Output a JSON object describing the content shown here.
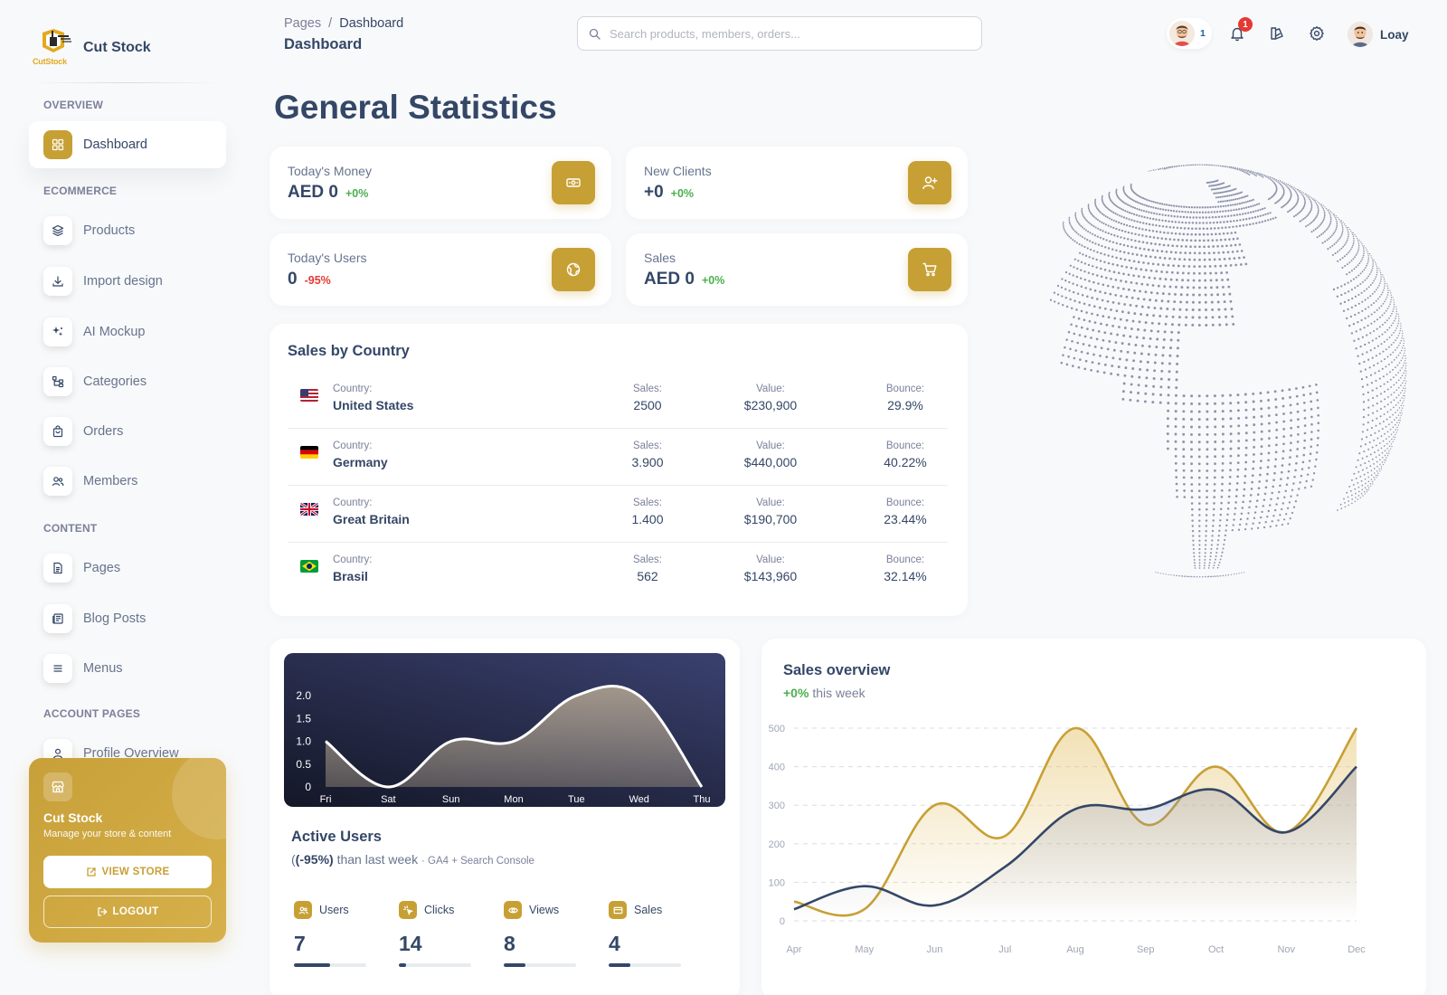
{
  "brand": {
    "name": "Cut Stock",
    "logo_text": "CutStock"
  },
  "sidebar": {
    "sections": {
      "overview": "OVERVIEW",
      "ecommerce": "ECOMMERCE",
      "content": "CONTENT",
      "account": "ACCOUNT PAGES"
    },
    "items": [
      {
        "label": "Dashboard",
        "icon": "dashboard-icon"
      },
      {
        "label": "Products",
        "icon": "layers-icon"
      },
      {
        "label": "Import design",
        "icon": "download-icon"
      },
      {
        "label": "AI Mockup",
        "icon": "sparkle-icon"
      },
      {
        "label": "Categories",
        "icon": "hierarchy-icon"
      },
      {
        "label": "Orders",
        "icon": "shopping-bag-icon"
      },
      {
        "label": "Members",
        "icon": "users-icon"
      },
      {
        "label": "Pages",
        "icon": "file-icon"
      },
      {
        "label": "Blog Posts",
        "icon": "newspaper-icon"
      },
      {
        "label": "Menus",
        "icon": "menu-icon"
      },
      {
        "label": "Profile Overview",
        "icon": "user-icon"
      }
    ],
    "store_card": {
      "title": "Cut Stock",
      "subtitle": "Manage your store & content",
      "view_store": "VIEW STORE",
      "logout": "LOGOUT"
    }
  },
  "topbar": {
    "breadcrumb_root": "Pages",
    "breadcrumb_sep": "/",
    "breadcrumb_current": "Dashboard",
    "title": "Dashboard",
    "search_placeholder": "Search products, members, orders...",
    "online_count": "1",
    "notification_count": "1",
    "user_name": "Loay"
  },
  "page_title": "General Statistics",
  "stats": [
    {
      "label": "Today's Money",
      "value": "AED 0",
      "change": "+0%",
      "trend": "positive",
      "icon": "money-icon"
    },
    {
      "label": "New Clients",
      "value": "+0",
      "change": "+0%",
      "trend": "positive",
      "icon": "user-plus-icon"
    },
    {
      "label": "Today's Users",
      "value": "0",
      "change": "-95%",
      "trend": "negative",
      "icon": "globe-icon"
    },
    {
      "label": "Sales",
      "value": "AED 0",
      "change": "+0%",
      "trend": "positive",
      "icon": "cart-icon"
    }
  ],
  "sales_by_country": {
    "title": "Sales by Country",
    "labels": {
      "country": "Country:",
      "sales": "Sales:",
      "value": "Value:",
      "bounce": "Bounce:"
    },
    "rows": [
      {
        "country": "United States",
        "sales": "2500",
        "value": "$230,900",
        "bounce": "29.9%",
        "flag": "us"
      },
      {
        "country": "Germany",
        "sales": "3.900",
        "value": "$440,000",
        "bounce": "40.22%",
        "flag": "de"
      },
      {
        "country": "Great Britain",
        "sales": "1.400",
        "value": "$190,700",
        "bounce": "23.44%",
        "flag": "gb"
      },
      {
        "country": "Brasil",
        "sales": "562",
        "value": "$143,960",
        "bounce": "32.14%",
        "flag": "br"
      }
    ]
  },
  "active_users": {
    "title": "Active Users",
    "change": "(-95%)",
    "change_prefix": "(",
    "text": "than last week",
    "source": "· GA4 + Search Console",
    "metrics": [
      {
        "label": "Users",
        "value": "7",
        "progress": 0.5,
        "icon": "users-icon"
      },
      {
        "label": "Clicks",
        "value": "14",
        "progress": 0.1,
        "icon": "cursor-click-icon"
      },
      {
        "label": "Views",
        "value": "8",
        "progress": 0.3,
        "icon": "eye-icon"
      },
      {
        "label": "Sales",
        "value": "4",
        "progress": 0.3,
        "icon": "credit-card-icon"
      }
    ]
  },
  "sales_overview": {
    "title": "Sales overview",
    "change": "+0%",
    "text": "this week"
  },
  "chart_data": [
    {
      "type": "area",
      "x": [
        "Fri",
        "Sat",
        "Sun",
        "Mon",
        "Tue",
        "Wed",
        "Thu"
      ],
      "series": [
        {
          "values": [
            1.0,
            0.0,
            1.0,
            1.0,
            2.0,
            2.0,
            0.0
          ]
        }
      ],
      "yticks": [
        "2.0",
        "1.5",
        "1.0",
        "0.5",
        "0"
      ],
      "ylim": [
        0,
        2
      ],
      "colors": {
        "line": "#ffffff",
        "fill": "#c8b79a"
      }
    },
    {
      "type": "line",
      "x": [
        "Apr",
        "May",
        "Jun",
        "Jul",
        "Aug",
        "Sep",
        "Oct",
        "Nov",
        "Dec"
      ],
      "series": [
        {
          "values": [
            50,
            30,
            300,
            220,
            500,
            250,
            400,
            230,
            500
          ],
          "color": "#c7a035"
        },
        {
          "values": [
            30,
            90,
            40,
            140,
            290,
            290,
            340,
            230,
            400
          ],
          "color": "#344767"
        }
      ],
      "yticks": [
        "500",
        "400",
        "300",
        "200",
        "100",
        "0"
      ],
      "ylim": [
        0,
        500
      ],
      "grid": true
    }
  ]
}
